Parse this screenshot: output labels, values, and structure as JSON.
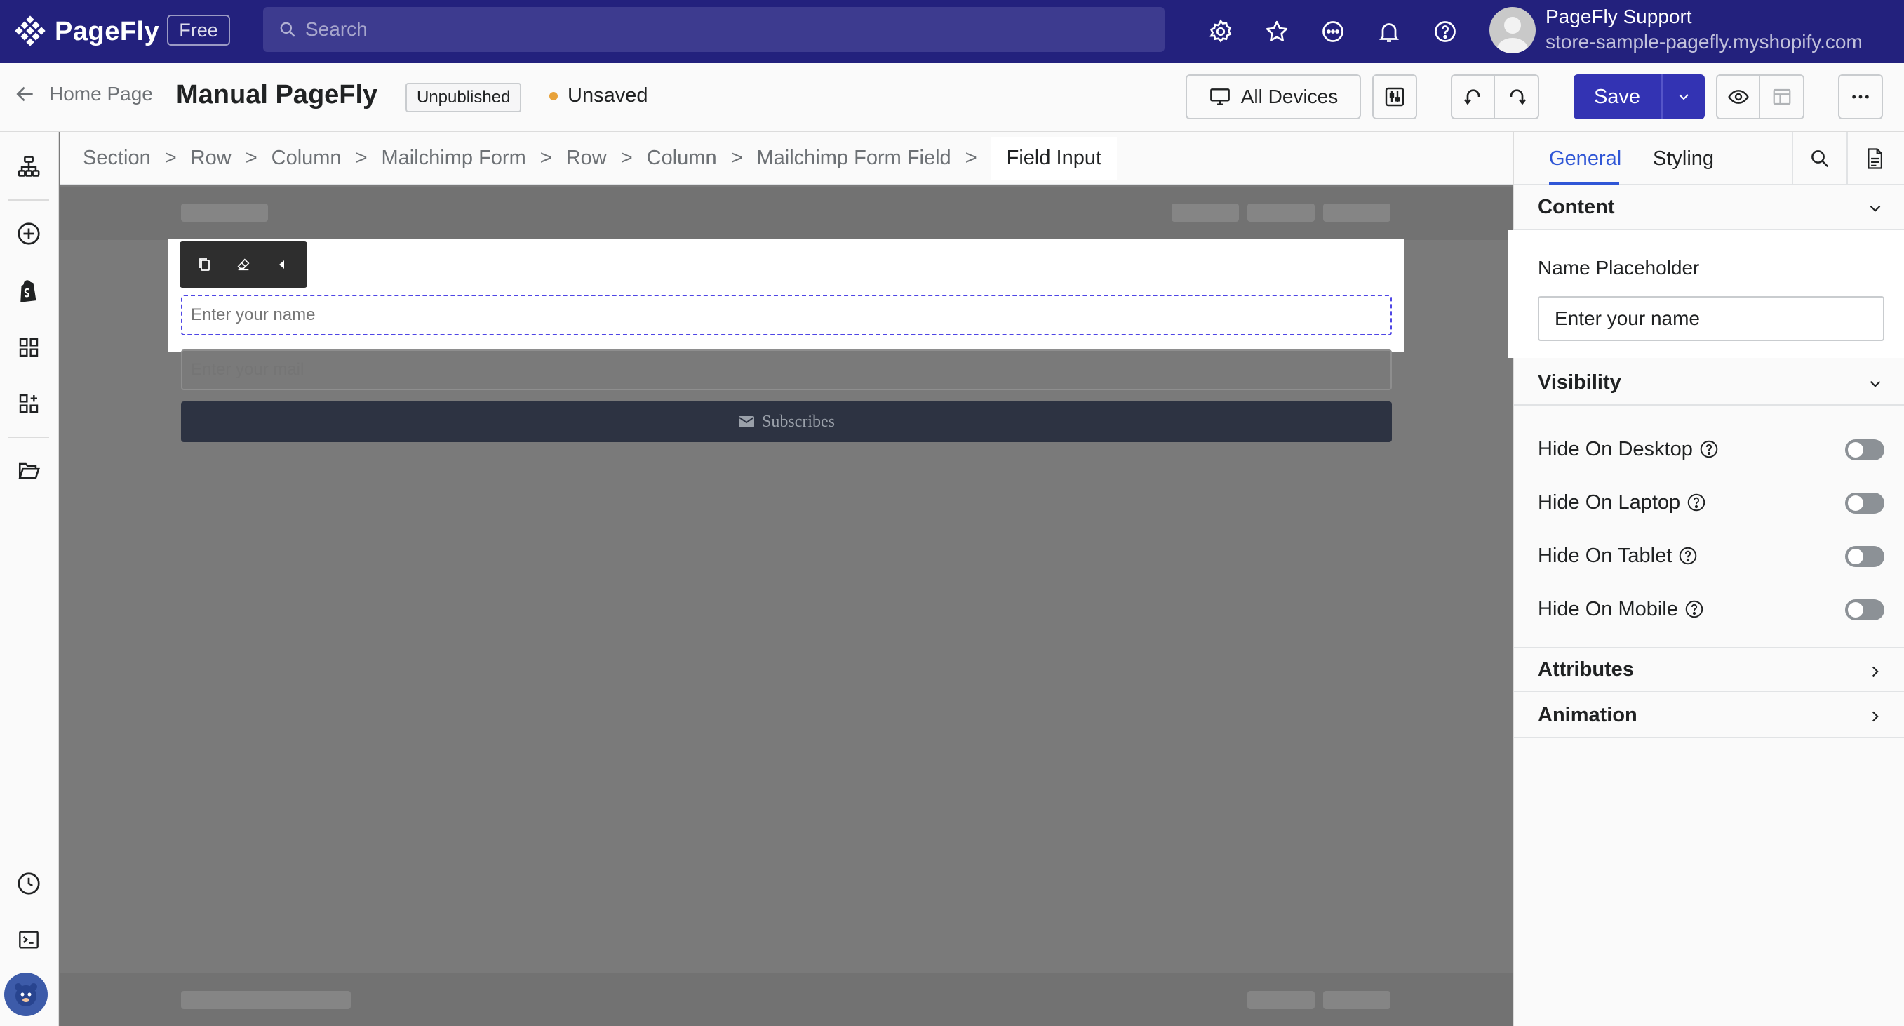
{
  "topbar": {
    "brand": "PageFly",
    "plan": "Free",
    "search_placeholder": "Search",
    "user_name": "PageFly Support",
    "user_store": "store-sample-pagefly.myshopify.com",
    "icons": [
      "settings-gear-icon",
      "star-icon",
      "chat-icon",
      "bell-icon",
      "help-icon"
    ]
  },
  "header": {
    "back_label": "Home Page",
    "page_title": "Manual PageFly",
    "status_badge": "Unpublished",
    "save_status": "Unsaved",
    "devices_label": "All Devices",
    "save_label": "Save"
  },
  "breadcrumb": [
    "Section",
    "Row",
    "Column",
    "Mailchimp Form",
    "Row",
    "Column",
    "Mailchimp Form Field"
  ],
  "breadcrumb_active": "Field Input",
  "canvas": {
    "name_placeholder": "Enter your name",
    "mail_placeholder": "Enter your mail",
    "subscribe_label": "Subscribes"
  },
  "panel": {
    "tabs": [
      "General",
      "Styling"
    ],
    "content_title": "Content",
    "name_placeholder_label": "Name Placeholder",
    "name_placeholder_value": "Enter your name",
    "visibility_title": "Visibility",
    "visibility": [
      {
        "label": "Hide On Desktop",
        "on": false
      },
      {
        "label": "Hide On Laptop",
        "on": false
      },
      {
        "label": "Hide On Tablet",
        "on": false
      },
      {
        "label": "Hide On Mobile",
        "on": false
      }
    ],
    "attributes_title": "Attributes",
    "animation_title": "Animation"
  },
  "colors": {
    "topbar_bg": "#23217d",
    "primary": "#3333b3",
    "active_tab": "#2f56d6",
    "selection_outline": "#4f46e5",
    "unsaved_dot": "#e8a23a"
  }
}
